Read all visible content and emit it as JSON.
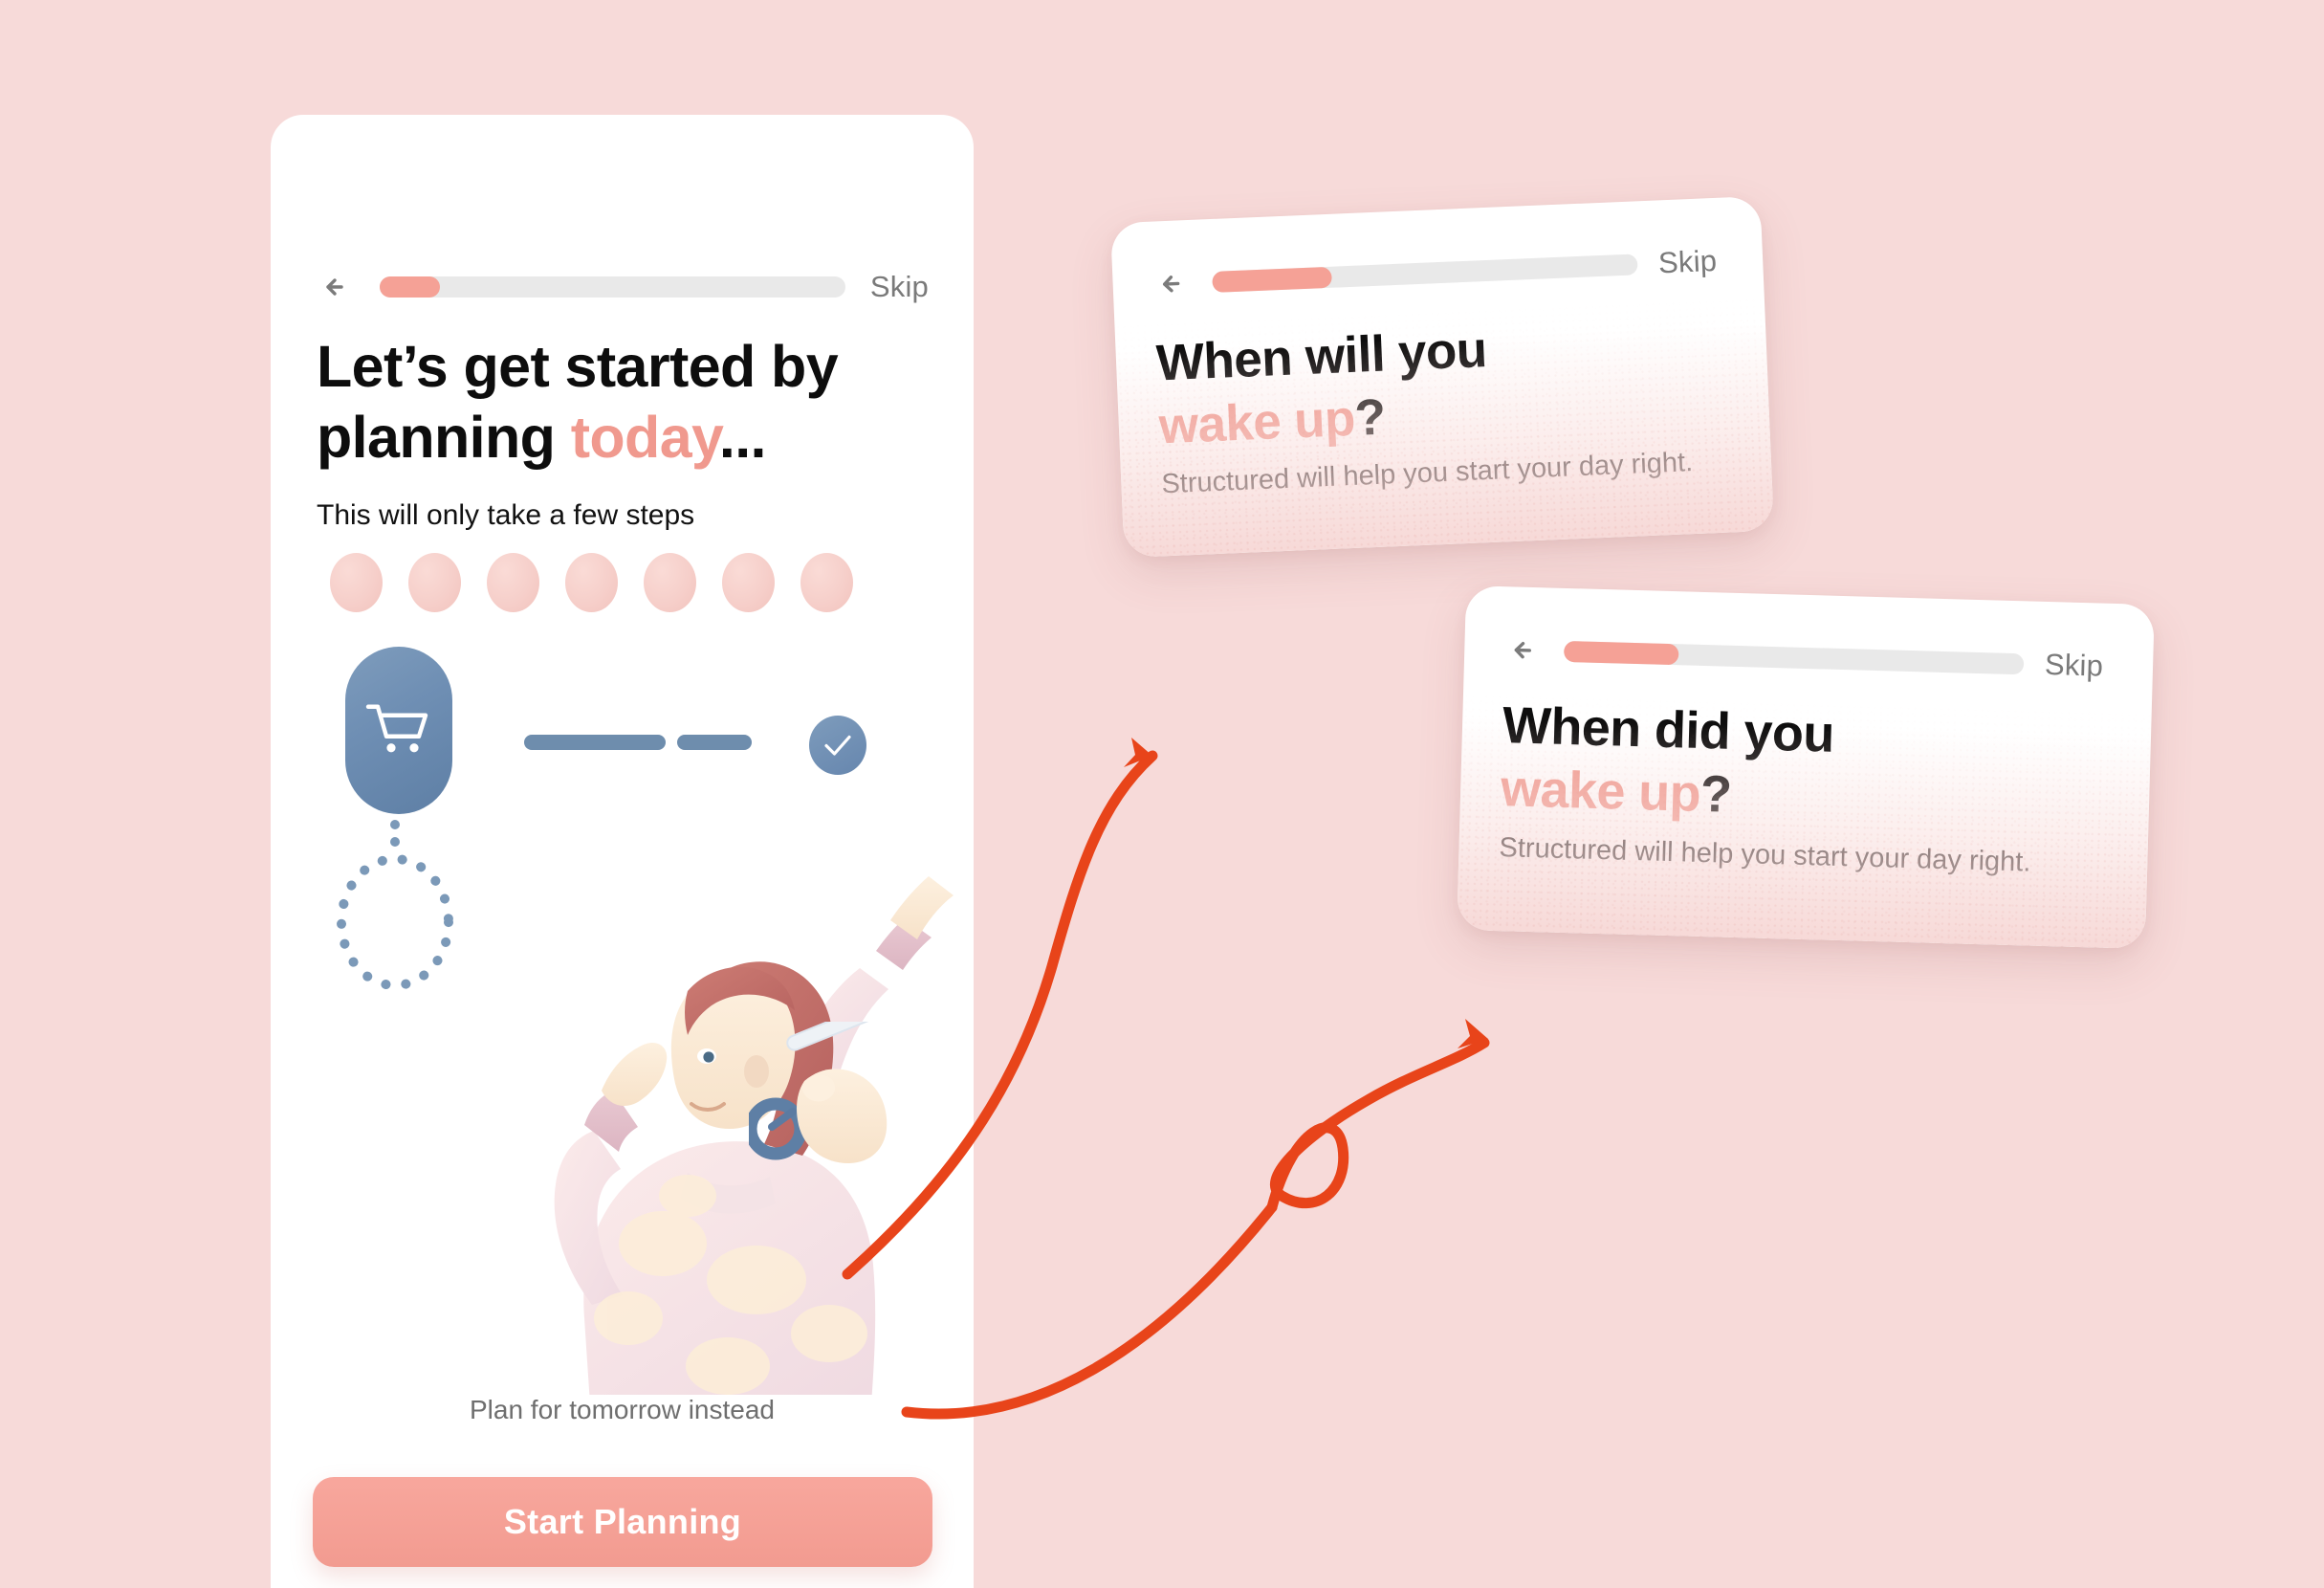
{
  "theme": {
    "background": "#F7DAD9",
    "accent_pink": "#F0998E",
    "progress_fill": "#F5A196",
    "progress_track": "#E9E9E9",
    "annotation_arrow": "#E8441A",
    "illustration_blue": "#6E8DAD",
    "cta_text": "#FFFFFF"
  },
  "main_screen": {
    "back_icon": "arrow-left-icon",
    "skip_label": "Skip",
    "progress_percent": 13,
    "headline_part1": "Let’s get started by planning ",
    "headline_accent": "today",
    "headline_part2": "...",
    "subtitle": "This will only take a few steps",
    "illustration": {
      "pink_dot_count": 7,
      "cart_icon": "shopping-cart-icon",
      "check_icon": "check-icon",
      "graduation_icon": "graduation-cap-icon",
      "pen_icon": "stylus-pen-icon",
      "dashed_line_count": 2
    },
    "footer_link": "Plan for tomorrow instead",
    "cta_label": "Start Planning"
  },
  "card_will": {
    "back_icon": "arrow-left-icon",
    "skip_label": "Skip",
    "progress_percent": 28,
    "headline_part1": "When will you",
    "headline_accent": "wake up",
    "headline_part2": "?",
    "body": "Structured will help you start your day right."
  },
  "card_did": {
    "back_icon": "arrow-left-icon",
    "skip_label": "Skip",
    "progress_percent": 25,
    "headline_part1": "When did you",
    "headline_accent": "wake up",
    "headline_part2": "?",
    "body": "Structured will help you start your day right."
  },
  "annotations": {
    "arrow_1_name": "arrow-to-when-will-you-card",
    "arrow_2_name": "looping-arrow-to-when-did-you-card"
  }
}
